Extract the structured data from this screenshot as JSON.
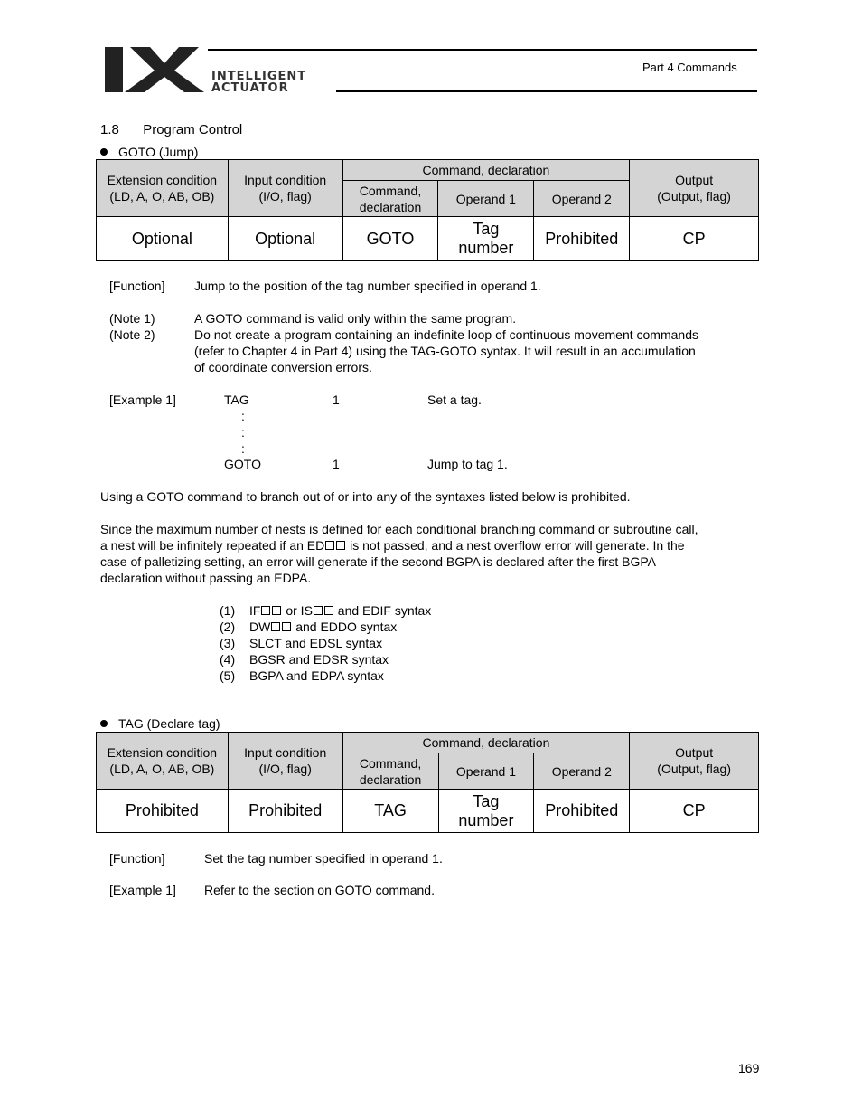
{
  "header": {
    "logo_mark": "IX",
    "logo_line1": "INTELLIGENT",
    "logo_line2": "ACTUATOR",
    "section_ref": "Part 4 Commands"
  },
  "section": {
    "number": "1.8",
    "title": "Program Control"
  },
  "table_headers": {
    "ext": [
      "Extension condition",
      "(LD, A, O, AB, OB)"
    ],
    "input": [
      "Input condition",
      "(I/O, flag)"
    ],
    "cmd_group": "Command, declaration",
    "cmd": [
      "Command,",
      "declaration"
    ],
    "op1": "Operand 1",
    "op2": "Operand 2",
    "output": [
      "Output",
      "(Output, flag)"
    ]
  },
  "goto": {
    "bullet": "GOTO (Jump)",
    "row": {
      "ext": "Optional",
      "input": "Optional",
      "cmd": "GOTO",
      "op1": [
        "Tag",
        "number"
      ],
      "op2": "Prohibited",
      "output": "CP"
    },
    "function_label": "[Function]",
    "function_text": "Jump to the position of the tag number specified in operand 1.",
    "note1_label": "(Note 1)",
    "note1_text": "A GOTO command is valid only within the same program.",
    "note2_label": "(Note 2)",
    "note2_lines": [
      "Do not create a program containing an indefinite loop of continuous movement commands",
      "(refer to Chapter 4 in Part 4) using the TAG-GOTO syntax. It will result in an accumulation",
      "of coordinate conversion errors."
    ],
    "example_label": "[Example 1]",
    "example_lines": [
      {
        "cmd": "TAG",
        "op": "1",
        "comment": "Set a tag."
      },
      {
        "cmd": "GOTO",
        "op": "1",
        "comment": "Jump to tag 1."
      }
    ],
    "ellipsis": ":",
    "para1": "Using a GOTO command to branch out of or into any of the syntaxes listed below is prohibited.",
    "para2_lines": [
      "Since the maximum number of nests is defined for each conditional branching command or subroutine call,",
      "case of palletizing setting, an error will generate if the second BGPA is declared after the first BGPA",
      "declaration without passing an EDPA."
    ],
    "para2_line2_pre": "a nest will be infinitely repeated if an ED",
    "para2_line2_post": " is not passed, and a nest overflow error will generate. In the",
    "list": [
      {
        "num": "(1)",
        "pre": "IF",
        "mid": " or IS",
        "post": " and EDIF syntax"
      },
      {
        "num": "(2)",
        "pre": "DW",
        "post": " and EDDO syntax"
      },
      {
        "num": "(3)",
        "text": "SLCT and EDSL syntax"
      },
      {
        "num": "(4)",
        "text": "BGSR and EDSR syntax"
      },
      {
        "num": "(5)",
        "text": "BGPA and EDPA syntax"
      }
    ]
  },
  "tag": {
    "bullet": "TAG (Declare tag)",
    "row": {
      "ext": "Prohibited",
      "input": "Prohibited",
      "cmd": "TAG",
      "op1": [
        "Tag",
        "number"
      ],
      "op2": "Prohibited",
      "output": "CP"
    },
    "function_label": "[Function]",
    "function_text": "Set the tag number specified in operand 1.",
    "example_label": "[Example 1]",
    "example_text": "Refer to the section on GOTO command."
  },
  "page_number": "169"
}
